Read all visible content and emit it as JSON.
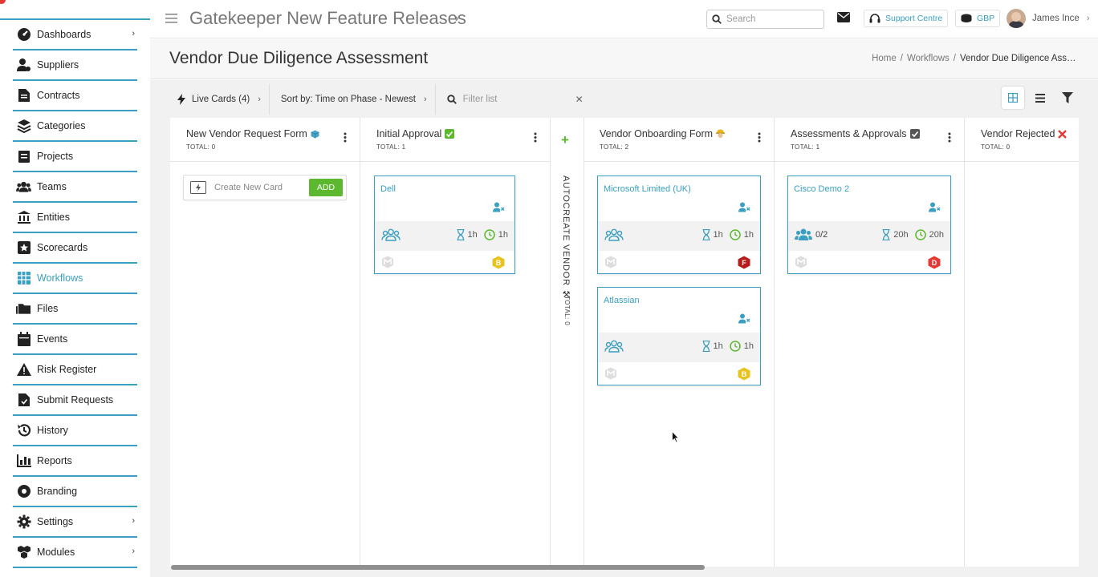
{
  "sidebar": {
    "items": [
      {
        "label": "Dashboards",
        "icon": "dashboard-icon",
        "chevron": true
      },
      {
        "label": "Suppliers",
        "icon": "suppliers-icon",
        "chevron": false
      },
      {
        "label": "Contracts",
        "icon": "contracts-icon",
        "chevron": false
      },
      {
        "label": "Categories",
        "icon": "categories-icon",
        "chevron": false
      },
      {
        "label": "Projects",
        "icon": "projects-icon",
        "chevron": false
      },
      {
        "label": "Teams",
        "icon": "teams-icon",
        "chevron": false
      },
      {
        "label": "Entities",
        "icon": "entities-icon",
        "chevron": false
      },
      {
        "label": "Scorecards",
        "icon": "scorecards-icon",
        "chevron": false
      },
      {
        "label": "Workflows",
        "icon": "workflows-icon",
        "chevron": false,
        "active": true
      },
      {
        "label": "Files",
        "icon": "files-icon",
        "chevron": false
      },
      {
        "label": "Events",
        "icon": "events-icon",
        "chevron": false
      },
      {
        "label": "Risk Register",
        "icon": "risk-icon",
        "chevron": false
      },
      {
        "label": "Submit Requests",
        "icon": "submit-icon",
        "chevron": false
      },
      {
        "label": "History",
        "icon": "history-icon",
        "chevron": false
      },
      {
        "label": "Reports",
        "icon": "reports-icon",
        "chevron": false
      },
      {
        "label": "Branding",
        "icon": "branding-icon",
        "chevron": false
      },
      {
        "label": "Settings",
        "icon": "settings-icon",
        "chevron": true
      },
      {
        "label": "Modules",
        "icon": "modules-icon",
        "chevron": true
      }
    ]
  },
  "header": {
    "title": "Gatekeeper New Feature Releases",
    "search_placeholder": "Search",
    "support_label": "Support Centre",
    "currency": "GBP",
    "user_name": "James Ince"
  },
  "page": {
    "title": "Vendor Due Diligence Assessment",
    "breadcrumbs": [
      "Home",
      "Workflows",
      "Vendor Due Diligence Asse..."
    ]
  },
  "toolbar": {
    "live_cards": "Live Cards (4)",
    "sort": "Sort by: Time on Phase - Newest",
    "filter_placeholder": "Filter list"
  },
  "columns": [
    {
      "name": "New Vendor Request Form",
      "total": "TOTAL: 0"
    },
    {
      "name": "Initial Approval",
      "total": "TOTAL: 1"
    },
    {
      "name": "Vendor Onboarding Form",
      "total": "TOTAL: 2"
    },
    {
      "name": "Assessments & Approvals",
      "total": "TOTAL: 1"
    },
    {
      "name": "Vendor Rejected",
      "total": "TOTAL: 0"
    }
  ],
  "autocreate": {
    "name": "AUTOCREATE VENDOR",
    "total": "TOTAL: 0"
  },
  "create_card": {
    "placeholder": "Create New Card",
    "add_label": "ADD"
  },
  "cards": [
    {
      "name": "Dell",
      "team": "",
      "time1": "1h",
      "time2": "1h",
      "grade": "B",
      "grade_color": "#e8c21e"
    },
    {
      "name": "Microsoft Limited (UK)",
      "team": "",
      "time1": "1h",
      "time2": "1h",
      "grade": "F",
      "grade_color": "#b71c1c"
    },
    {
      "name": "Atlassian",
      "team": "",
      "time1": "1h",
      "time2": "1h",
      "grade": "B",
      "grade_color": "#e8c21e"
    },
    {
      "name": "Cisco Demo 2",
      "team": "0/2",
      "time1": "20h",
      "time2": "20h",
      "grade": "D",
      "grade_color": "#e53935"
    }
  ],
  "colors": {
    "accent": "#3a9fc0",
    "add_green": "#5cb82e",
    "reject_red": "#e53935"
  }
}
